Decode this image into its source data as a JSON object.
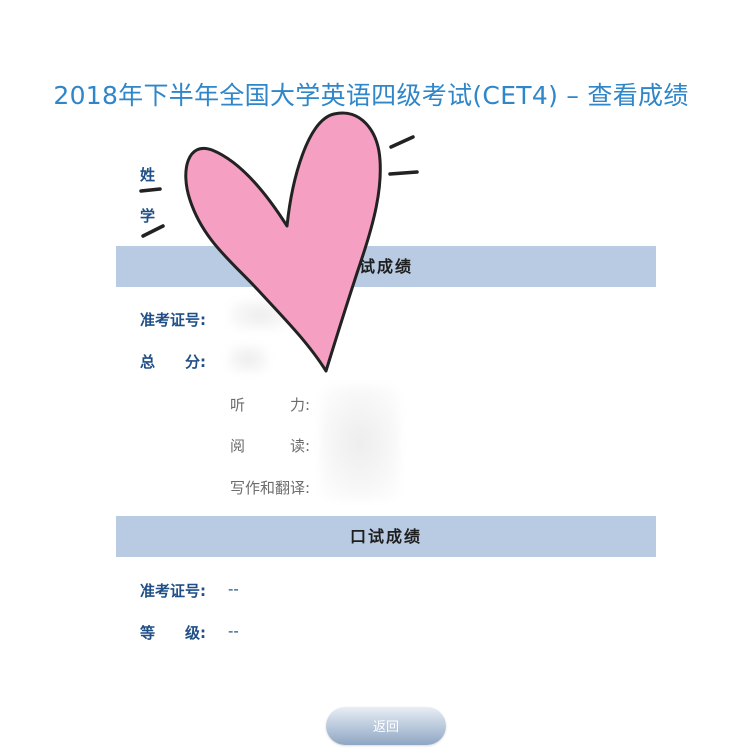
{
  "page_title": "2018年下半年全国大学英语四级考试(CET4) – 查看成绩",
  "personal_info": {
    "name_label": "姓",
    "school_label": "学"
  },
  "written_section": {
    "title": "试成绩",
    "ticket_label": "准考证号:",
    "total_label": "总　　分:",
    "components": [
      {
        "label": "听　　　力:"
      },
      {
        "label": "阅　　　读:"
      },
      {
        "label": "写作和翻译:"
      }
    ]
  },
  "oral_section": {
    "title": "口试成绩",
    "ticket_label": "准考证号:",
    "ticket_value": "--",
    "grade_label": "等　　级:",
    "grade_value": "--"
  },
  "back_button_label": "返回",
  "overlay": {
    "heart_color": "#f59fc3",
    "outline_color": "#222222"
  }
}
